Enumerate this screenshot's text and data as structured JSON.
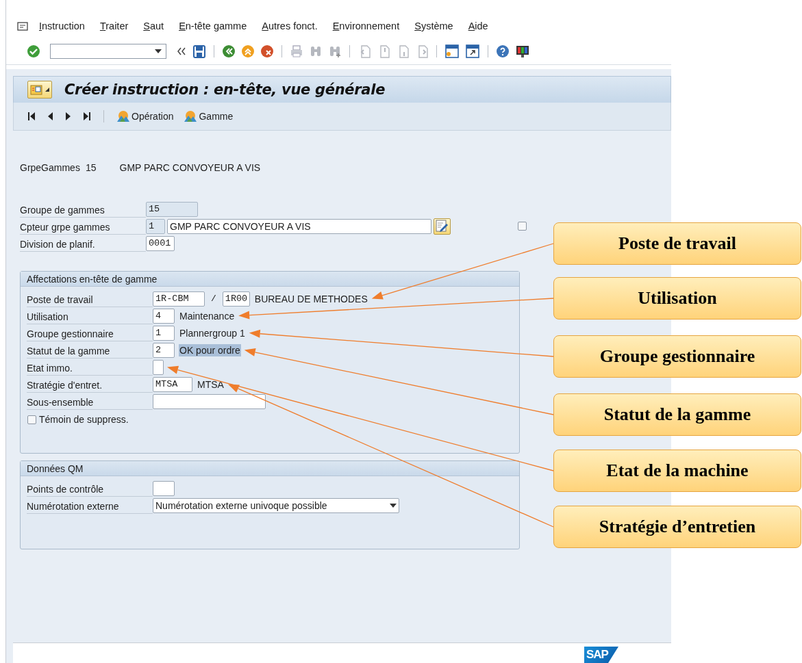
{
  "menu": [
    {
      "label": "Instruction"
    },
    {
      "label": "Traiter"
    },
    {
      "label": "Saut"
    },
    {
      "label": "En-tête gamme"
    },
    {
      "label": "Autres fonct."
    },
    {
      "label": "Environnement"
    },
    {
      "label": "Système"
    },
    {
      "label": "Aide"
    }
  ],
  "title": "Créer instruction : en-tête, vue générale",
  "nav_buttons": [
    "Opération",
    "Gamme"
  ],
  "header_line": {
    "label": "GrpeGammes",
    "number": "15",
    "name": "GMP PARC CONVOYEUR A VIS"
  },
  "header_fields": [
    {
      "label": "Groupe de gammes",
      "inputs": [
        {
          "kind": "readonly",
          "value": "15"
        }
      ]
    },
    {
      "label": "Cpteur grpe gammes",
      "inputs": [
        {
          "kind": "readonly",
          "value": "1"
        },
        {
          "kind": "text",
          "value": "GMP PARC CONVOYEUR A VIS"
        }
      ],
      "long_text_button": true,
      "checkbox": {
        "checked": false
      }
    },
    {
      "label": "Division de planif.",
      "inputs": [
        {
          "kind": "code",
          "value": "0001"
        }
      ]
    }
  ],
  "groups": [
    {
      "title": "Affectations en-tête de gamme",
      "rows": [
        {
          "label": "Poste de travail",
          "inputs": [
            {
              "kind": "code",
              "value": "1R-CBM"
            },
            {
              "kind": "code",
              "value": "1R00"
            }
          ],
          "separator": "/",
          "description": "BUREAU DE METHODES",
          "highlighted": false
        },
        {
          "label": "Utilisation",
          "inputs": [
            {
              "kind": "code",
              "value": "4"
            }
          ],
          "description": "Maintenance",
          "highlighted": false
        },
        {
          "label": "Groupe gestionnaire",
          "inputs": [
            {
              "kind": "code",
              "value": "1"
            }
          ],
          "description": "Plannergroup 1",
          "highlighted": false
        },
        {
          "label": "Statut de la gamme",
          "inputs": [
            {
              "kind": "code",
              "value": "2"
            }
          ],
          "description": "OK pour ordre",
          "highlighted": true
        },
        {
          "label": "Etat immo.",
          "inputs": [
            {
              "kind": "code"
            }
          ]
        },
        {
          "label": "Stratégie d'entret.",
          "inputs": [
            {
              "kind": "code",
              "value": "MTSA"
            }
          ],
          "description": "MTSA",
          "highlighted": false
        },
        {
          "label": "Sous-ensemble",
          "inputs": [
            {
              "kind": "code"
            }
          ]
        }
      ],
      "checkbox": {
        "label": "Témoin de suppress.",
        "checked": false
      }
    },
    {
      "title": "Données QM",
      "rows": [
        {
          "label": "Points de contrôle",
          "inputs": [
            {
              "kind": "code"
            }
          ]
        },
        {
          "label": "Numérotation externe",
          "inputs": [
            {
              "kind": "dropdown",
              "value": "Numérotation externe univoque possible"
            }
          ]
        }
      ]
    }
  ],
  "callouts": [
    {
      "label": "Poste de travail"
    },
    {
      "label": "Utilisation"
    },
    {
      "label": "Groupe gestionnaire"
    },
    {
      "label": "Statut de la gamme"
    },
    {
      "label": "Etat de la machine"
    },
    {
      "label": "Stratégie d’entretien"
    }
  ],
  "logo": "SAP"
}
